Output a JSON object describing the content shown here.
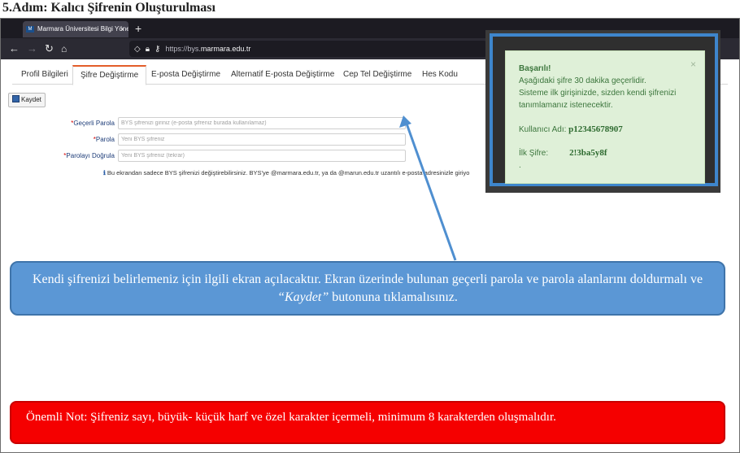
{
  "heading": "5.Adım: Kalıcı Şifrenin Oluşturulması",
  "browser": {
    "tab_title": "Marmara Üniversitesi Bilgi Yöne",
    "tab_close": "×",
    "new_tab": "+",
    "url_prefix": "https://bys.",
    "url_host": "marmara.edu.tr"
  },
  "page_tabs": [
    "Profil Bilgileri",
    "Şifre Değiştirme",
    "E-posta Değiştirme",
    "Alternatif E-posta Değiştirme",
    "Cep Tel Değiştirme",
    "Hes Kodu"
  ],
  "active_tab": "Şifre Değiştirme",
  "toolbar": {
    "save_label": "Kaydet"
  },
  "form": {
    "current_label": "Geçerli Parola",
    "current_placeholder": "BYS şifrenizi giriniz (e-posta şifreniz burada kullanılamaz)",
    "new_label": "Parola",
    "new_placeholder": "Yeni BYS şifreniz",
    "confirm_label": "Parolayı Doğrula",
    "confirm_placeholder": "Yeni BYS şifreniz (tekrar)",
    "required_mark": "*"
  },
  "info_note": "Bu ekrandan sadece BYS şifrenizi değiştirebilirsiniz. BYS'ye @marmara.edu.tr, ya da @marun.edu.tr uzantılı e-posta adresinizle giriyo",
  "popup": {
    "title": "Başarılı!",
    "line1": "Aşağıdaki şifre 30 dakika geçerlidir.",
    "line2": "Sisteme ilk girişinizde, sizden kendi şifrenizi",
    "line3": "tanımlamanız istenecektir.",
    "username_label": "Kullanıcı Adı:",
    "username_value": "p12345678907",
    "password_label": "İlk Şifre:",
    "password_value": "2!3ba5y8f",
    "trailing": ".",
    "close": "×"
  },
  "callout": {
    "text_before": "Kendi şifrenizi belirlemeniz için ilgili ekran açılacaktır. Ekran üzerinde   bulunan geçerli parola ve parola alanlarını doldurmalı ve ",
    "emphasis": "“Kaydet”",
    "text_after": " butonuna tıklamalısınız."
  },
  "note": "Önemli Not: Şifreniz sayı, büyük- küçük harf ve özel karakter içermeli, minimum 8 karakterden oluşmalıdır.",
  "colors": {
    "callout": "#5b97d5",
    "note": "#f50000",
    "popup_bg": "#dff0d8",
    "active_tab_accent": "#e35d2a",
    "popup_frame": "#3e86cc"
  }
}
